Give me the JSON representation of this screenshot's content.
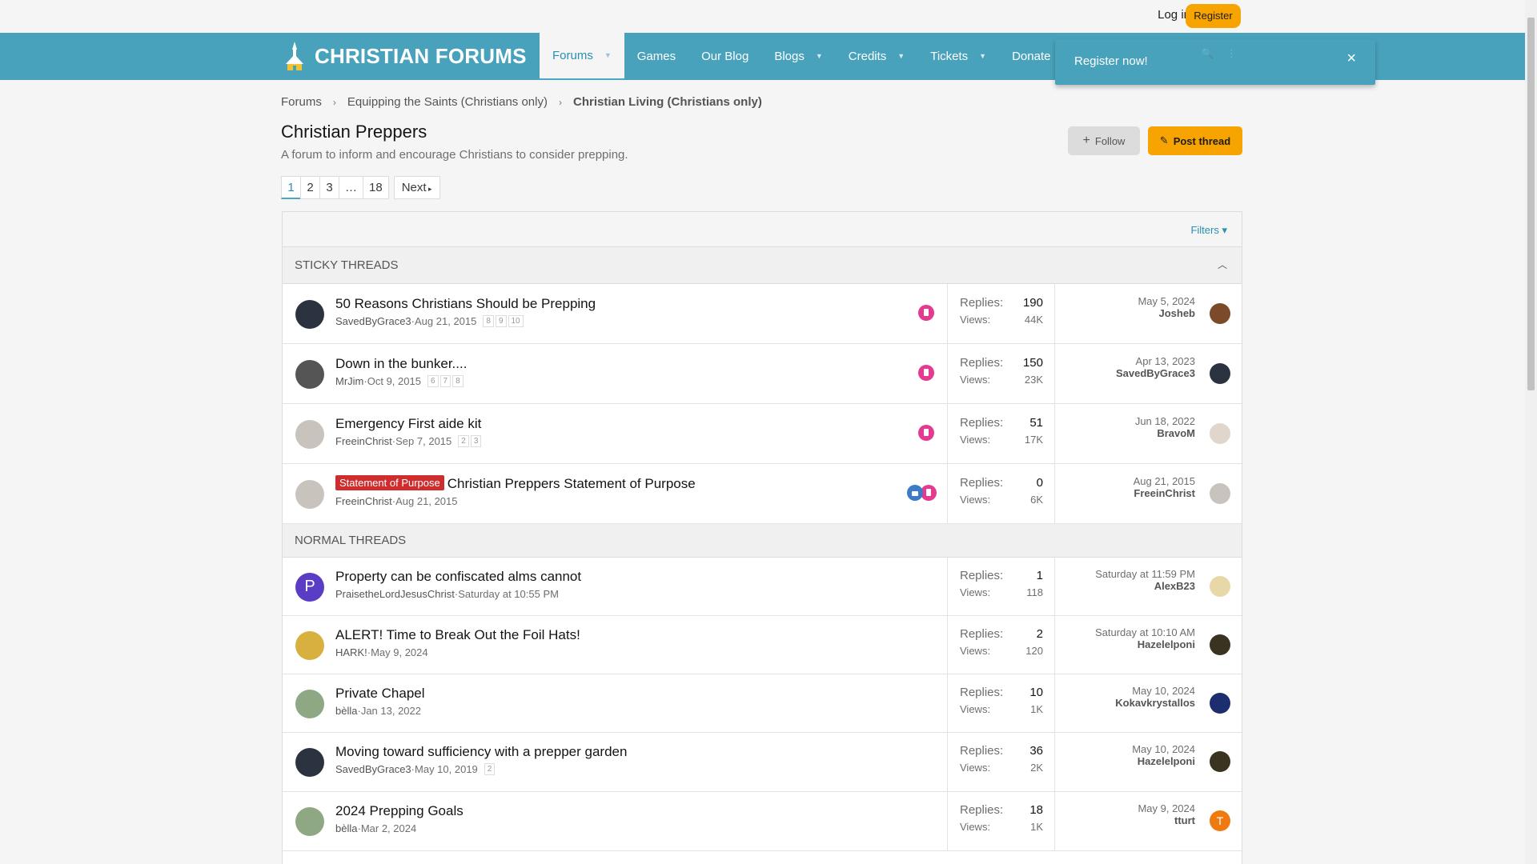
{
  "header": {
    "login": "Log in",
    "register": "Register"
  },
  "logo": {
    "text": "CHRISTIAN FORUMS"
  },
  "nav": [
    {
      "label": "Forums",
      "has_caret": true
    },
    {
      "label": "Games",
      "has_caret": false
    },
    {
      "label": "Our Blog",
      "has_caret": false
    },
    {
      "label": "Blogs",
      "has_caret": true
    },
    {
      "label": "Credits",
      "has_caret": true
    },
    {
      "label": "Tickets",
      "has_caret": true
    },
    {
      "label": "Donate",
      "has_caret": false
    }
  ],
  "popup": {
    "text": "Register now!",
    "close": "×"
  },
  "breadcrumb": [
    "Forums",
    "Equipping the Saints (Christians only)",
    "Christian Living (Christians only)"
  ],
  "page": {
    "title": "Christian Preppers",
    "description": "A forum to inform and encourage Christians to consider prepping."
  },
  "buttons": {
    "follow": "Follow",
    "post_thread": "Post thread"
  },
  "pagination": {
    "pages": [
      "1",
      "2",
      "3",
      "…",
      "18"
    ],
    "next": "Next"
  },
  "filters": "Filters",
  "labels": {
    "replies": "Replies:",
    "views": "Views:"
  },
  "sections": {
    "sticky": "STICKY THREADS",
    "normal": "NORMAL THREADS"
  },
  "sticky_threads": [
    {
      "title": "50 Reasons Christians Should be Prepping",
      "author": "SavedByGrace3",
      "date": "Aug 21, 2015",
      "pages": [
        "8",
        "9",
        "10"
      ],
      "replies": "190",
      "views": "44K",
      "last_date": "May 5, 2024",
      "last_user": "Josheb",
      "avatar_color": "#2c3340",
      "last_avatar_color": "#7a4a2b"
    },
    {
      "title": "Down in the bunker....",
      "author": "MrJim",
      "date": "Oct 9, 2015",
      "pages": [
        "6",
        "7",
        "8"
      ],
      "replies": "150",
      "views": "23K",
      "last_date": "Apr 13, 2023",
      "last_user": "SavedByGrace3",
      "avatar_color": "#555555",
      "last_avatar_color": "#2c3340"
    },
    {
      "title": "Emergency First aide kit",
      "author": "FreeinChrist",
      "date": "Sep 7, 2015",
      "pages": [
        "2",
        "3"
      ],
      "replies": "51",
      "views": "17K",
      "last_date": "Jun 18, 2022",
      "last_user": "BravoM",
      "avatar_color": "#c9c3bd",
      "last_avatar_color": "#e0d6cc"
    },
    {
      "title": "Christian Preppers Statement of Purpose",
      "prefix": "Statement of Purpose",
      "author": "FreeinChrist",
      "date": "Aug 21, 2015",
      "pages": [],
      "replies": "0",
      "views": "6K",
      "last_date": "Aug 21, 2015",
      "last_user": "FreeinChrist",
      "avatar_color": "#c9c3bd",
      "last_avatar_color": "#c9c3bd"
    }
  ],
  "normal_threads": [
    {
      "title": "Property can be confiscated alms cannot",
      "author": "PraisetheLordJesusChrist",
      "date": "Saturday at 10:55 PM",
      "pages": [],
      "replies": "1",
      "views": "118",
      "last_date": "Saturday at 11:59 PM",
      "last_user": "AlexB23",
      "avatar_letter": "P",
      "avatar_color": "#5b3cc4",
      "last_avatar_color": "#e8d8a8"
    },
    {
      "title": "ALERT! Time to Break Out the Foil Hats!",
      "author": "HARK!",
      "date": "May 9, 2024",
      "pages": [],
      "replies": "2",
      "views": "120",
      "last_date": "Saturday at 10:10 AM",
      "last_user": "Hazelelponi",
      "avatar_color": "#d8b040",
      "last_avatar_color": "#3a3320"
    },
    {
      "title": "Private Chapel",
      "author": "bèlla",
      "date": "Jan 13, 2022",
      "pages": [],
      "replies": "10",
      "views": "1K",
      "last_date": "May 10, 2024",
      "last_user": "Kokavkrystallos",
      "avatar_color": "#8fa884",
      "last_avatar_color": "#1c2e6e"
    },
    {
      "title": "Moving toward sufficiency with a prepper garden",
      "author": "SavedByGrace3",
      "date": "May 10, 2019",
      "pages": [
        "2"
      ],
      "replies": "36",
      "views": "2K",
      "last_date": "May 10, 2024",
      "last_user": "Hazelelponi",
      "avatar_color": "#2c3340",
      "last_avatar_color": "#3a3320"
    },
    {
      "title": "2024 Prepping Goals",
      "author": "bèlla",
      "date": "Mar 2, 2024",
      "pages": [],
      "replies": "18",
      "views": "1K",
      "last_date": "May 9, 2024",
      "last_user": "tturt",
      "avatar_color": "#8fa884",
      "last_avatar_color": "#f07a10",
      "last_avatar_letter": "T"
    }
  ]
}
